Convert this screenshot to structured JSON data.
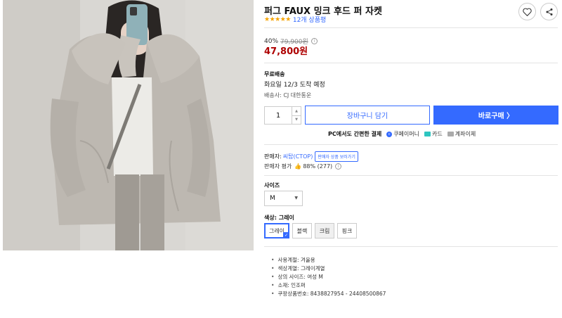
{
  "product": {
    "title": "퍼그 FAUX 밍크 후드 퍼 자켓",
    "stars": "★★★★★",
    "review_count": "12개 상품평",
    "rating_value": 5
  },
  "pricing": {
    "discount": "40%",
    "original_price": "79,900원",
    "sale_price": "47,800원",
    "info_icon": "i"
  },
  "shipping": {
    "free_label": "무료배송",
    "arrival": "화요일 12/3 도착 예정",
    "carrier": "배송사: CJ 대한통운"
  },
  "purchase": {
    "quantity": "1",
    "cart_label": "장바구니 담기",
    "buy_label": "바로구매 〉"
  },
  "payment": {
    "title": "PC에서도 간편한 결제",
    "methods": [
      "쿠페이머니",
      "카드",
      "계좌이체"
    ],
    "coupay_glyph": "c"
  },
  "seller": {
    "label": "판매자:",
    "name": "씨탑(CTOP)",
    "more_label": "판매자 상품 보러가기",
    "rating_label": "판매자 평가",
    "rating_value": "88% (277)"
  },
  "options": {
    "size_label": "사이즈",
    "size_selected": "M",
    "color_label": "색상: 그레이",
    "colors": [
      "그레이",
      "블랙",
      "크림",
      "핑크"
    ]
  },
  "attributes": [
    "사용계절: 겨울용",
    "색상계열: 그레이계열",
    "상의 사이즈: 여성 M",
    "소재: 인조퍼",
    "쿠팡상품번호: 8438827954 - 24408500867"
  ],
  "colors": {
    "accent": "#346aff",
    "sale_price": "#ae0000",
    "star": "#f6a300"
  },
  "icons": {
    "wishlist": "heart-icon",
    "share": "share-icon"
  }
}
